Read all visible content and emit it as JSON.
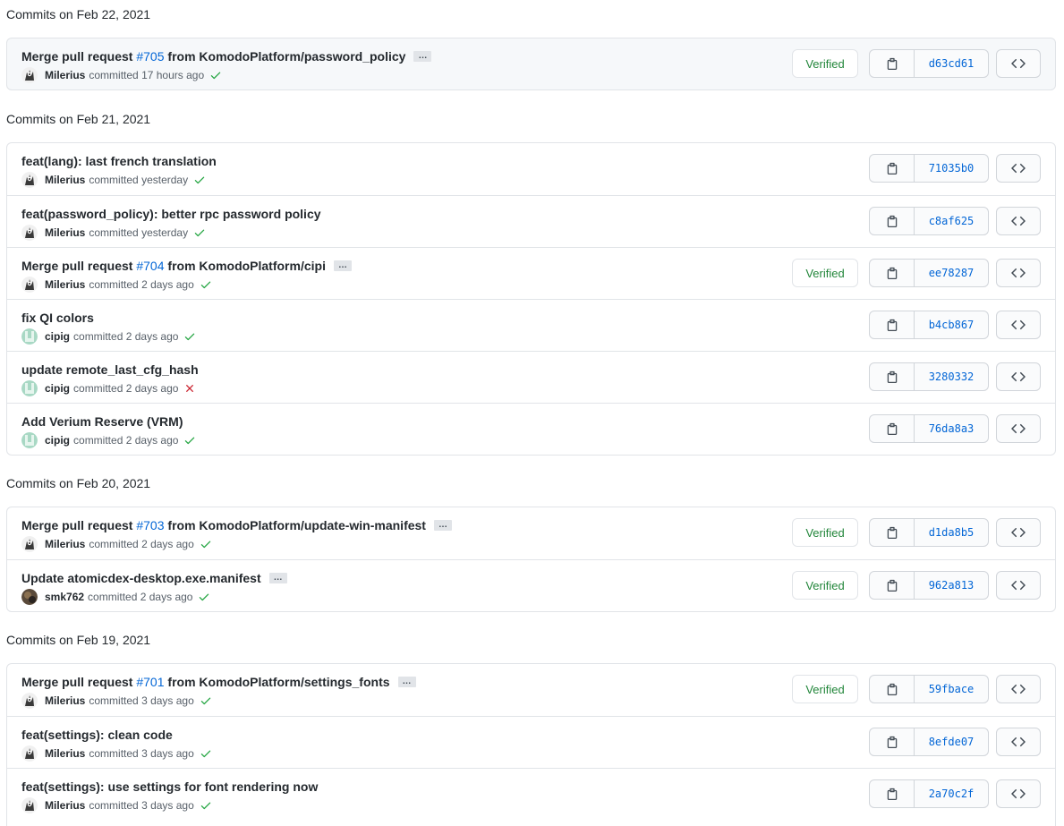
{
  "colors": {
    "link": "#0366d6",
    "verified": "#22863a",
    "success": "#28a745",
    "failure": "#cb2431",
    "border": "#e1e4e8"
  },
  "labels": {
    "committed": "committed",
    "verified": "Verified",
    "ellipsis": "…"
  },
  "groups": [
    {
      "header": "Commits on Feb 22, 2021",
      "commits": [
        {
          "msg_pre": "Merge pull request ",
          "pr": "#705",
          "msg_post": " from KomodoPlatform/password_policy",
          "has_ellipsis": true,
          "author": "Milerius",
          "avatar": "milerius",
          "time": "17 hours ago",
          "status": "success",
          "verified": true,
          "sha": "d63cd61"
        }
      ]
    },
    {
      "header": "Commits on Feb 21, 2021",
      "commits": [
        {
          "msg_pre": "feat(lang): last french translation",
          "pr": "",
          "msg_post": "",
          "has_ellipsis": false,
          "author": "Milerius",
          "avatar": "milerius",
          "time": "yesterday",
          "status": "success",
          "verified": false,
          "sha": "71035b0"
        },
        {
          "msg_pre": "feat(password_policy): better rpc password policy",
          "pr": "",
          "msg_post": "",
          "has_ellipsis": false,
          "author": "Milerius",
          "avatar": "milerius",
          "time": "yesterday",
          "status": "success",
          "verified": false,
          "sha": "c8af625"
        },
        {
          "msg_pre": "Merge pull request ",
          "pr": "#704",
          "msg_post": " from KomodoPlatform/cipi",
          "has_ellipsis": true,
          "author": "Milerius",
          "avatar": "milerius",
          "time": "2 days ago",
          "status": "success",
          "verified": true,
          "sha": "ee78287"
        },
        {
          "msg_pre": "fix QI colors",
          "pr": "",
          "msg_post": "",
          "has_ellipsis": false,
          "author": "cipig",
          "avatar": "cipig",
          "time": "2 days ago",
          "status": "success",
          "verified": false,
          "sha": "b4cb867"
        },
        {
          "msg_pre": "update remote_last_cfg_hash",
          "pr": "",
          "msg_post": "",
          "has_ellipsis": false,
          "author": "cipig",
          "avatar": "cipig",
          "time": "2 days ago",
          "status": "failure",
          "verified": false,
          "sha": "3280332"
        },
        {
          "msg_pre": "Add Verium Reserve (VRM)",
          "pr": "",
          "msg_post": "",
          "has_ellipsis": false,
          "author": "cipig",
          "avatar": "cipig",
          "time": "2 days ago",
          "status": "success",
          "verified": false,
          "sha": "76da8a3"
        }
      ]
    },
    {
      "header": "Commits on Feb 20, 2021",
      "commits": [
        {
          "msg_pre": "Merge pull request ",
          "pr": "#703",
          "msg_post": " from KomodoPlatform/update-win-manifest",
          "has_ellipsis": true,
          "author": "Milerius",
          "avatar": "milerius",
          "time": "2 days ago",
          "status": "success",
          "verified": true,
          "sha": "d1da8b5"
        },
        {
          "msg_pre": "Update atomicdex-desktop.exe.manifest",
          "pr": "",
          "msg_post": "",
          "has_ellipsis": true,
          "author": "smk762",
          "avatar": "smk762",
          "time": "2 days ago",
          "status": "success",
          "verified": true,
          "sha": "962a813"
        }
      ]
    },
    {
      "header": "Commits on Feb 19, 2021",
      "commits": [
        {
          "msg_pre": "Merge pull request ",
          "pr": "#701",
          "msg_post": " from KomodoPlatform/settings_fonts",
          "has_ellipsis": true,
          "author": "Milerius",
          "avatar": "milerius",
          "time": "3 days ago",
          "status": "success",
          "verified": true,
          "sha": "59fbace"
        },
        {
          "msg_pre": "feat(settings): clean code",
          "pr": "",
          "msg_post": "",
          "has_ellipsis": false,
          "author": "Milerius",
          "avatar": "milerius",
          "time": "3 days ago",
          "status": "success",
          "verified": false,
          "sha": "8efde07"
        },
        {
          "msg_pre": "feat(settings): use settings for font rendering now",
          "pr": "",
          "msg_post": "",
          "has_ellipsis": false,
          "author": "Milerius",
          "avatar": "milerius",
          "time": "3 days ago",
          "status": "success",
          "verified": false,
          "sha": "2a70c2f"
        }
      ]
    }
  ]
}
